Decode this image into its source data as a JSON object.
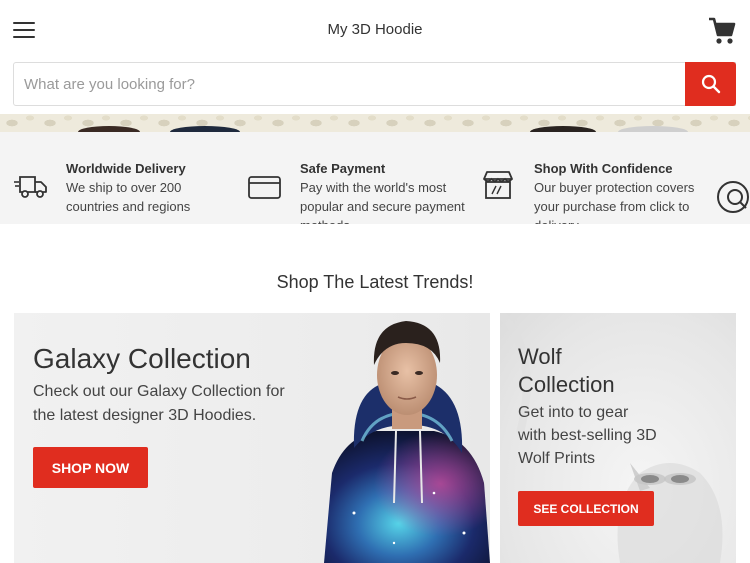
{
  "header": {
    "site_title": "My 3D Hoodie",
    "menu_icon": "hamburger-menu-icon",
    "cart_icon": "shopping-cart-icon"
  },
  "search": {
    "placeholder": "What are you looking for?",
    "value": "",
    "button_icon": "search-icon"
  },
  "features": [
    {
      "icon": "delivery-truck-icon",
      "title": "Worldwide Delivery",
      "desc": "We ship to over 200 countries and regions"
    },
    {
      "icon": "credit-card-icon",
      "title": "Safe Payment",
      "desc": "Pay with the world's most popular and secure payment methods"
    },
    {
      "icon": "storefront-icon",
      "title": "Shop With Confidence",
      "desc": "Our buyer protection covers your purchase from click to delivery"
    },
    {
      "icon": "support-icon"
    }
  ],
  "section": {
    "title": "Shop The Latest Trends!"
  },
  "promos": {
    "galaxy": {
      "title": "Galaxy Collection",
      "desc": "Check out our Galaxy Collection for the latest designer 3D Hoodies.",
      "button": "SHOP NOW"
    },
    "wolf": {
      "title": "Wolf Collection",
      "desc": "Get into to gear with best-selling 3D Wolf Prints",
      "button": "SEE COLLECTION"
    }
  },
  "colors": {
    "accent": "#e02d1f",
    "features_bg": "#f4f4f4",
    "text": "#333333"
  }
}
